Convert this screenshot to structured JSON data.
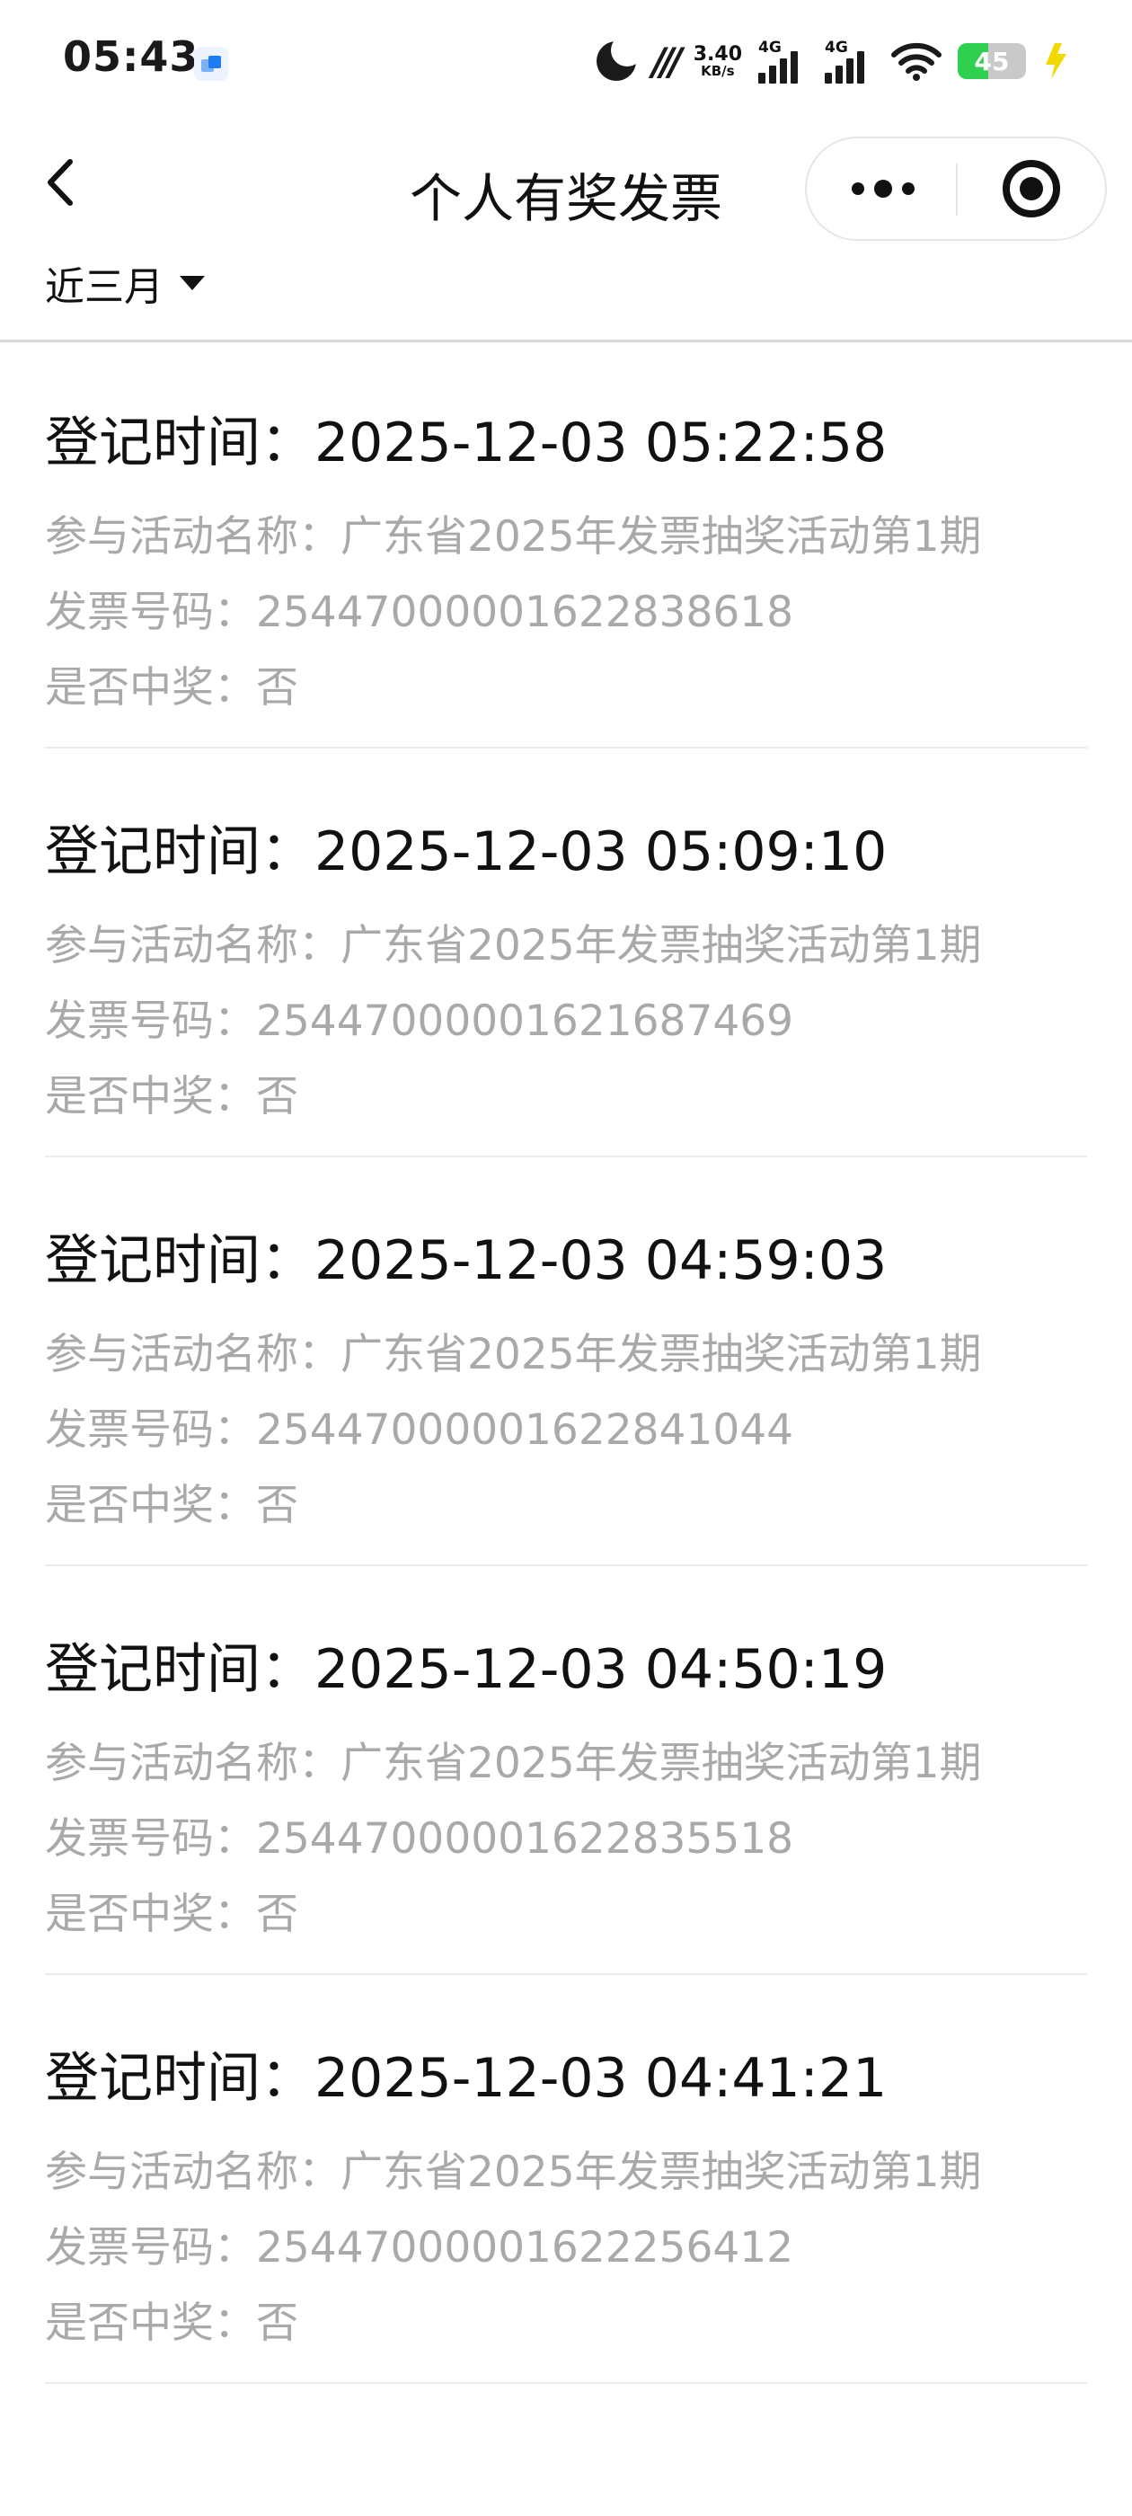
{
  "status_bar": {
    "time": "05:43",
    "network_speed_value": "3.40",
    "network_speed_unit": "KB/s",
    "signal_1_label": "4G",
    "signal_2_label": "4G",
    "battery_percent": "45",
    "battery_level": 0.45,
    "icons": [
      "moon-icon",
      "mm-logo-icon",
      "signal-icon",
      "wifi-icon",
      "battery-icon",
      "charging-bolt-icon"
    ],
    "colors": {
      "battery_fill": "#2fcf4f",
      "charging_bolt": "#f2d900",
      "app_icon": "#1e7bf0"
    }
  },
  "nav": {
    "title": "个人有奖发票",
    "back_icon": "chevron-left-icon",
    "more_icon": "more-dots-icon",
    "close_icon": "target-close-icon"
  },
  "filter": {
    "selected": "近三月",
    "icon": "caret-down-icon"
  },
  "labels": {
    "time": "登记时间：",
    "activity": "参与活动名称：",
    "invoice": "发票号码：",
    "won": "是否中奖："
  },
  "records": [
    {
      "time": "",
      "activity": "",
      "invoice": "",
      "won": "否"
    },
    {
      "time": "2025-12-03 05:22:58",
      "activity": "广东省2025年发票抽奖活动第1期",
      "invoice": "25447000001622838618",
      "won": "否"
    },
    {
      "time": "2025-12-03 05:09:10",
      "activity": "广东省2025年发票抽奖活动第1期",
      "invoice": "25447000001621687469",
      "won": "否"
    },
    {
      "time": "2025-12-03 04:59:03",
      "activity": "广东省2025年发票抽奖活动第1期",
      "invoice": "25447000001622841044",
      "won": "否"
    },
    {
      "time": "2025-12-03 04:50:19",
      "activity": "广东省2025年发票抽奖活动第1期",
      "invoice": "25447000001622835518",
      "won": "否"
    },
    {
      "time": "2025-12-03 04:41:21",
      "activity": "广东省2025年发票抽奖活动第1期",
      "invoice": "25447000001622256412",
      "won": "否"
    }
  ]
}
